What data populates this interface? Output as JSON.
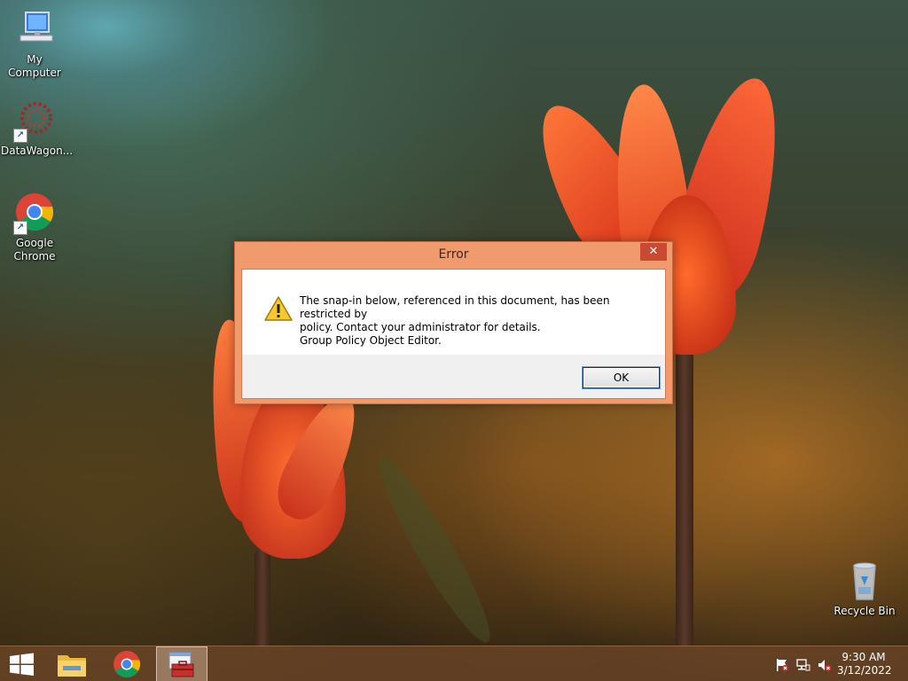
{
  "desktop": {
    "icons": [
      {
        "label": "My Computer",
        "icon": "my-computer-icon"
      },
      {
        "label": "DataWagon...",
        "icon": "datawagon-icon"
      },
      {
        "label": "Google Chrome",
        "icon": "chrome-icon"
      },
      {
        "label": "Recycle Bin",
        "icon": "recycle-bin-icon"
      }
    ]
  },
  "dialog": {
    "title": "Error",
    "close_glyph": "✕",
    "message_lines": [
      "The snap-in below, referenced in this document, has been restricted by",
      "policy. Contact your administrator for details.",
      "Group Policy Object Editor."
    ],
    "ok_label": "OK",
    "icon": "warning-icon"
  },
  "taskbar": {
    "items": [
      {
        "name": "start-button",
        "icon": "windows-logo-icon"
      },
      {
        "name": "file-explorer",
        "icon": "folder-icon"
      },
      {
        "name": "chrome",
        "icon": "chrome-icon"
      },
      {
        "name": "mmc-console",
        "icon": "toolbox-icon",
        "active": true
      }
    ],
    "tray": [
      "action-center-flag-icon",
      "network-icon",
      "volume-muted-icon"
    ],
    "time": "9:30 AM",
    "date": "3/12/2022"
  },
  "colors": {
    "dialog_frame": "#f09a6e",
    "close_button": "#c84a32",
    "taskbar": "#6e4628"
  }
}
